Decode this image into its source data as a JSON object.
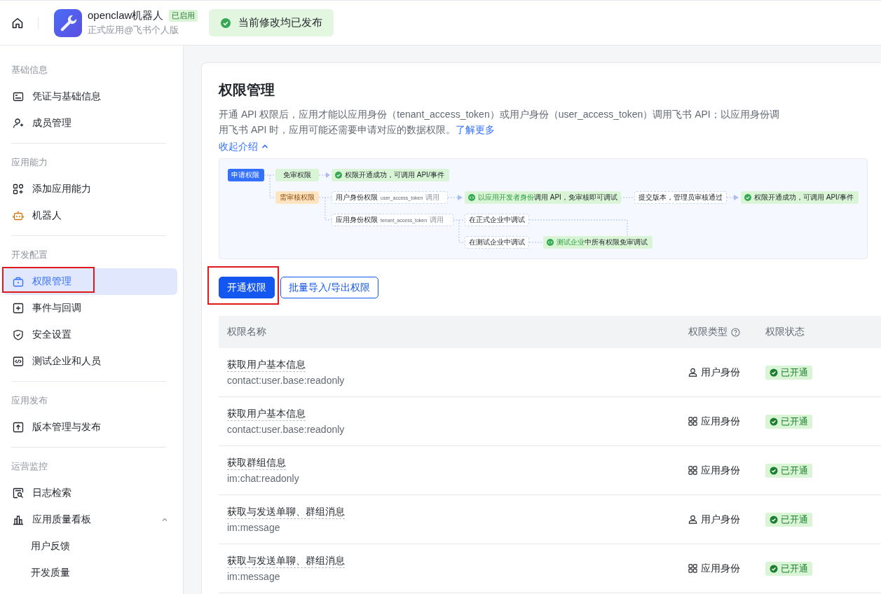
{
  "header": {
    "app": {
      "name": "openclaw机器人",
      "status_badge": "已启用",
      "subtitle": "正式应用@飞书个人版"
    },
    "publish_notice": "当前修改均已发布"
  },
  "sidebar": {
    "groups": [
      {
        "title": "基础信息",
        "items": [
          {
            "label": "凭证与基础信息",
            "selected": false,
            "highlighted": false
          },
          {
            "label": "成员管理",
            "selected": false,
            "highlighted": false
          }
        ]
      },
      {
        "title": "应用能力",
        "items": [
          {
            "label": "添加应用能力",
            "selected": false,
            "highlighted": false
          },
          {
            "label": "机器人",
            "selected": false,
            "highlighted": false
          }
        ]
      },
      {
        "title": "开发配置",
        "items": [
          {
            "label": "权限管理",
            "selected": true,
            "highlighted": true
          },
          {
            "label": "事件与回调",
            "selected": false,
            "highlighted": false
          },
          {
            "label": "安全设置",
            "selected": false,
            "highlighted": false
          },
          {
            "label": "测试企业和人员",
            "selected": false,
            "highlighted": false
          }
        ]
      },
      {
        "title": "应用发布",
        "items": [
          {
            "label": "版本管理与发布",
            "selected": false,
            "highlighted": false
          }
        ]
      },
      {
        "title": "运营监控",
        "items": [
          {
            "label": "日志检索",
            "selected": false,
            "highlighted": false
          },
          {
            "label": "应用质量看板",
            "selected": false,
            "highlighted": false,
            "expanded": true,
            "children": [
              {
                "label": "用户反馈",
                "selected": false
              },
              {
                "label": "开发质量",
                "selected": false
              }
            ]
          }
        ]
      }
    ]
  },
  "page": {
    "title": "权限管理",
    "description": "开通 API 权限后，应用才能以应用身份（tenant_access_token）或用户身份（user_access_token）调用飞书 API；以应用身份调用飞书 API 时，应用可能还需要申请对应的数据权限。",
    "learn_more_link": "了解更多",
    "collapse_link": "收起介绍",
    "flow_diagram": {
      "nodes": [
        {
          "kind": "start",
          "text": "申请权限"
        },
        {
          "kind": "free",
          "text": "免审权限"
        },
        {
          "kind": "success",
          "text": "权限开通成功，可调用 API/事件"
        },
        {
          "kind": "review",
          "text": "需审核权限"
        },
        {
          "kind": "step",
          "text": "用户身份权限",
          "token": "user_access_token",
          "suffix": "调用"
        },
        {
          "kind": "info",
          "highlight": "以应用开发者身份",
          "text": "调用 API，免审核即可调试"
        },
        {
          "kind": "step",
          "text": "提交版本，管理员审核通过"
        },
        {
          "kind": "success",
          "text": "权限开通成功，可调用 API/事件"
        },
        {
          "kind": "step",
          "text": "应用身份权限",
          "token": "tenant_access_token",
          "suffix": "调用"
        },
        {
          "kind": "step",
          "text": "在正式企业中调试"
        },
        {
          "kind": "step",
          "text": "在测试企业中调试"
        },
        {
          "kind": "info",
          "highlight": "测试企业",
          "text": "中所有权限免审调试"
        }
      ]
    },
    "buttons": [
      {
        "label": "开通权限",
        "kind": "primary",
        "highlighted": true
      },
      {
        "label": "批量导入/导出权限",
        "kind": "outline",
        "highlighted": false
      }
    ],
    "table": {
      "columns": [
        {
          "label": "权限名称",
          "help": false
        },
        {
          "label": "权限类型",
          "help": true
        },
        {
          "label": "权限状态",
          "help": false
        }
      ],
      "rows": [
        {
          "name": "获取用户基本信息",
          "scope": "contact:user.base:readonly",
          "kind": "user",
          "type": "用户身份",
          "status": "已开通"
        },
        {
          "name": "获取用户基本信息",
          "scope": "contact:user.base:readonly",
          "kind": "app",
          "type": "应用身份",
          "status": "已开通"
        },
        {
          "name": "获取群组信息",
          "scope": "im:chat:readonly",
          "kind": "app",
          "type": "应用身份",
          "status": "已开通"
        },
        {
          "name": "获取与发送单聊、群组消息",
          "scope": "im:message",
          "kind": "user",
          "type": "用户身份",
          "status": "已开通"
        },
        {
          "name": "获取与发送单聊、群组消息",
          "scope": "im:message",
          "kind": "app",
          "type": "应用身份",
          "status": "已开通"
        }
      ]
    }
  }
}
